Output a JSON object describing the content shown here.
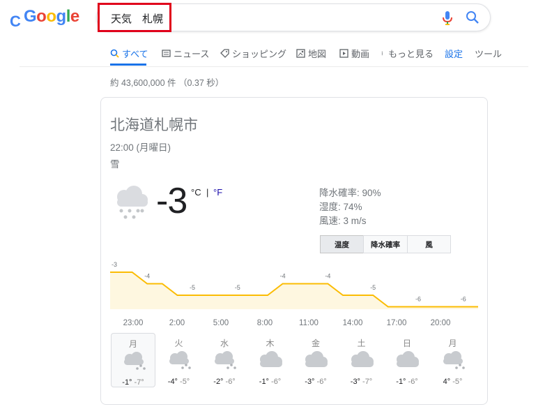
{
  "search": {
    "query": "天気　札幌"
  },
  "tabs": [
    {
      "label": "すべて",
      "icon": "search-icon"
    },
    {
      "label": "ニュース",
      "icon": "news-icon"
    },
    {
      "label": "ショッピング",
      "icon": "tag-icon"
    },
    {
      "label": "地図",
      "icon": "map-icon"
    },
    {
      "label": "動画",
      "icon": "video-icon"
    },
    {
      "label": "もっと見る",
      "icon": "more-icon"
    },
    {
      "label": "設定"
    },
    {
      "label": "ツール"
    }
  ],
  "result_stats": "約 43,600,000 件 （0.37 秒）",
  "weather": {
    "location": "北海道札幌市",
    "datetime": "22:00 (月曜日)",
    "condition": "雪",
    "icon": "snow-icon",
    "temperature": "-3",
    "unit_c": "°C",
    "unit_sep": "|",
    "unit_f": "°F",
    "precipitation": "降水確率: 90%",
    "humidity": "湿度: 74%",
    "wind": "風速: 3 m/s",
    "modes": [
      "温度",
      "降水確率",
      "風"
    ],
    "active_mode": "温度"
  },
  "chart_data": {
    "type": "area",
    "x": [
      "22:00",
      "23:00",
      "0:00",
      "1:00",
      "2:00",
      "3:00",
      "4:00",
      "5:00",
      "6:00",
      "7:00",
      "8:00",
      "9:00",
      "10:00",
      "11:00",
      "12:00",
      "13:00",
      "14:00",
      "15:00",
      "16:00",
      "17:00",
      "18:00",
      "19:00",
      "20:00",
      "21:00"
    ],
    "values": [
      -3,
      -3,
      -4,
      -4,
      -5,
      -5,
      -5,
      -5,
      -5,
      -5,
      -5,
      -4,
      -4,
      -4,
      -4,
      -5,
      -5,
      -5,
      -6,
      -6,
      -6,
      -6,
      -6,
      -6
    ],
    "point_labels": [
      {
        "index": 0,
        "text": "-3"
      },
      {
        "index": 2,
        "text": "-4"
      },
      {
        "index": 5,
        "text": "-5"
      },
      {
        "index": 8,
        "text": "-5"
      },
      {
        "index": 11,
        "text": "-4"
      },
      {
        "index": 14,
        "text": "-4"
      },
      {
        "index": 17,
        "text": "-5"
      },
      {
        "index": 20,
        "text": "-6"
      },
      {
        "index": 23,
        "text": "-6"
      }
    ],
    "tick_labels": [
      "23:00",
      "2:00",
      "5:00",
      "8:00",
      "11:00",
      "14:00",
      "17:00",
      "20:00"
    ],
    "line_color": "#fbbc04",
    "fill_color": "#fef7e0"
  },
  "forecast": [
    {
      "day": "月",
      "hi": "-1°",
      "lo": "-7°",
      "icon": "snow-icon"
    },
    {
      "day": "火",
      "hi": "-4°",
      "lo": "-5°",
      "icon": "snow-icon"
    },
    {
      "day": "水",
      "hi": "-2°",
      "lo": "-6°",
      "icon": "snow-icon"
    },
    {
      "day": "木",
      "hi": "-1°",
      "lo": "-6°",
      "icon": "cloud-icon"
    },
    {
      "day": "金",
      "hi": "-3°",
      "lo": "-6°",
      "icon": "cloud-icon"
    },
    {
      "day": "土",
      "hi": "-3°",
      "lo": "-7°",
      "icon": "cloud-icon"
    },
    {
      "day": "日",
      "hi": "-1°",
      "lo": "-6°",
      "icon": "cloud-icon"
    },
    {
      "day": "月",
      "hi": "4°",
      "lo": "-5°",
      "icon": "snow-icon"
    }
  ]
}
